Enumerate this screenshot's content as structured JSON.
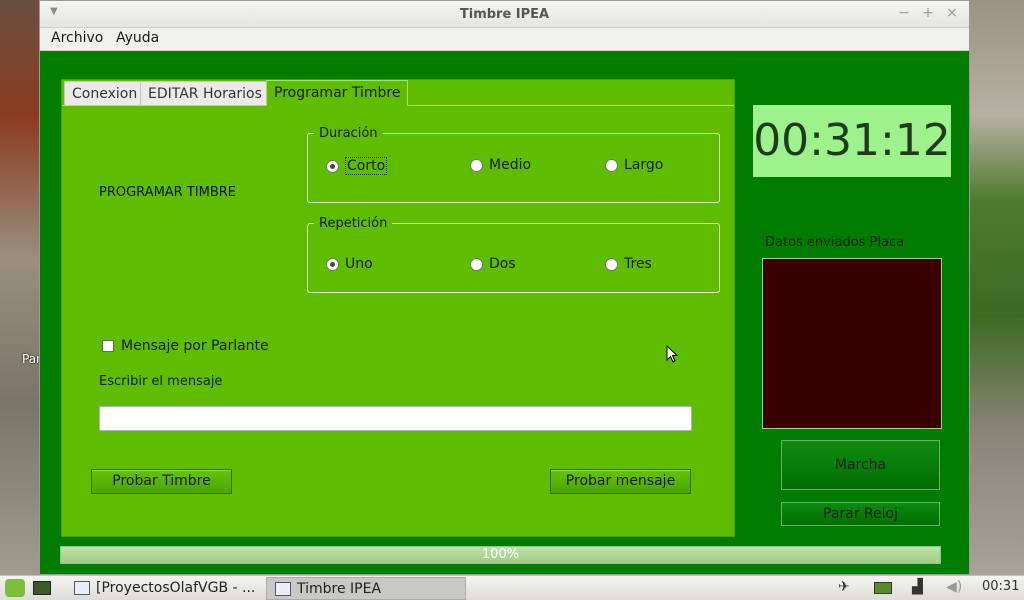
{
  "desktop": {
    "partial_label": "Par"
  },
  "window": {
    "title": "Timbre IPEA",
    "controls": {
      "minimize": "−",
      "maximize": "+",
      "close": "×"
    }
  },
  "menu": {
    "items": [
      "Archivo",
      "Ayuda"
    ]
  },
  "tabs": [
    {
      "label": "Conexion"
    },
    {
      "label": "EDITAR Horarios"
    },
    {
      "label": "Programar Timbre"
    }
  ],
  "panel": {
    "heading": "PROGRAMAR TIMBRE",
    "duracion": {
      "legend": "Duración",
      "options": [
        "Corto",
        "Medio",
        "Largo"
      ],
      "selected": "Corto"
    },
    "repeticion": {
      "legend": "Repetición",
      "options": [
        "Uno",
        "Dos",
        "Tres"
      ],
      "selected": "Uno"
    },
    "mensaje_checkbox": {
      "label": "Mensaje por Parlante",
      "checked": false
    },
    "escribir_label": "Escribir  el mensaje",
    "mensaje_input": {
      "value": "",
      "placeholder": ""
    },
    "probar_timbre": "Probar Timbre",
    "probar_mensaje": "Probar mensaje"
  },
  "side": {
    "clock": "00:31:12",
    "datos_label": "Datos enviados Placa",
    "marcha": "Marcha",
    "parar_reloj": "Parar Reloj"
  },
  "progress": {
    "value": 1.0,
    "label": "100%"
  },
  "taskbar": {
    "tasks": [
      {
        "label": "[ProyectosOlafVGB - ..."
      },
      {
        "label": "Timbre IPEA"
      }
    ],
    "time": "00:31"
  },
  "colors": {
    "window_bg": "#007d00",
    "panel_bg": "#5fbd00",
    "clock_bg": "#9ef28c",
    "datos_bg": "#390000"
  }
}
